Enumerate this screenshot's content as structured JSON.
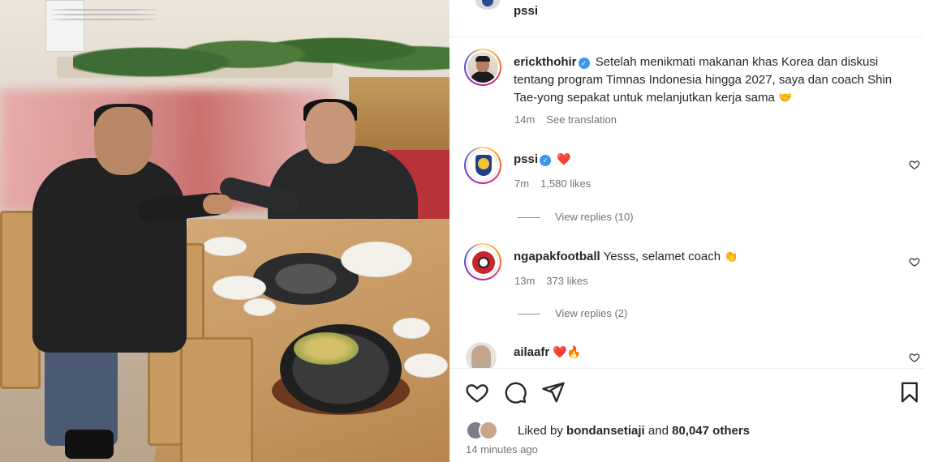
{
  "header": {
    "username": "pssi"
  },
  "comments": [
    {
      "username": "erickthohir",
      "verified": true,
      "text": "Setelah menikmati makanan khas Korea dan diskusi tentang program Timnas Indonesia hingga 2027, saya dan coach Shin Tae-yong sepakat untuk melanjutkan kerja sama",
      "emoji": "🤝",
      "time": "14m",
      "translation_label": "See translation"
    },
    {
      "username": "pssi",
      "verified": true,
      "text": "",
      "emoji": "❤️",
      "time": "7m",
      "likes": "1,580 likes",
      "replies": "View replies (10)"
    },
    {
      "username": "ngapakfootball",
      "verified": false,
      "text": "Yesss, selamet coach",
      "emoji": "👏",
      "time": "13m",
      "likes": "373 likes",
      "replies": "View replies (2)"
    },
    {
      "username": "ailaafr",
      "verified": false,
      "text": "",
      "emoji": "❤️🔥"
    }
  ],
  "actions": {
    "liked_by_prefix": "Liked by",
    "liked_by_user": "bondansetiaji",
    "liked_by_and": "and",
    "liked_by_others": "80,047 others",
    "time_ago": "14 minutes ago"
  },
  "colors": {
    "verified": "#3897f0",
    "heart": "#ed4956",
    "muted_text": "#737373"
  },
  "icons": [
    "heart-icon",
    "comment-icon",
    "share-icon",
    "bookmark-icon",
    "verified-icon"
  ]
}
